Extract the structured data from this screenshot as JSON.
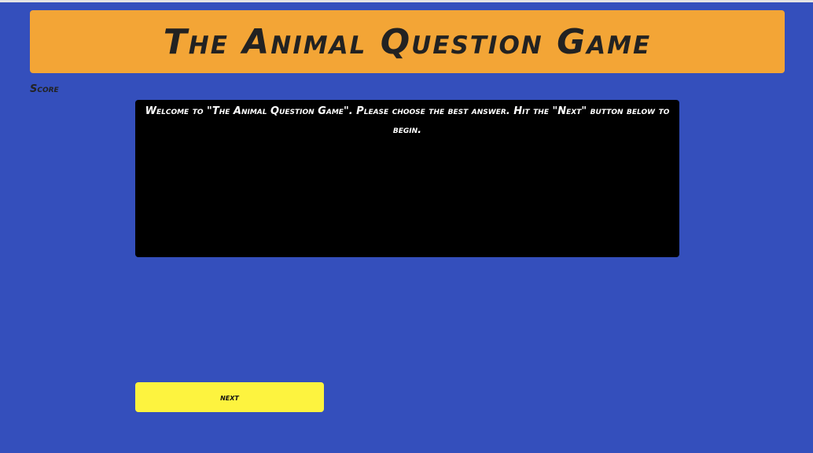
{
  "header": {
    "title": "The Animal Question Game"
  },
  "score": {
    "label": "Score"
  },
  "question": {
    "text": "Welcome to \"The Animal Question Game\". Please choose the best answer. Hit the \"Next\" button below to begin."
  },
  "controls": {
    "next_label": "next"
  },
  "colors": {
    "background": "#344fbc",
    "header": "#f3a536",
    "question_box": "#000000",
    "next_button": "#fdf33f"
  }
}
